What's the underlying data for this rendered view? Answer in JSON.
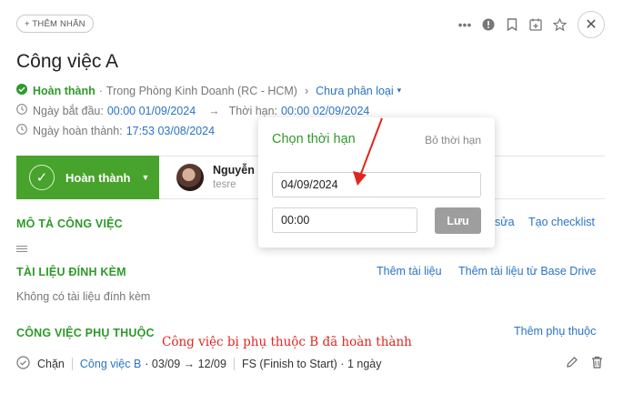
{
  "header": {
    "add_label": "+ THÊM NHÃN",
    "title": "Công việc A"
  },
  "status_line": {
    "status": "Hoàn thành",
    "separator": "·",
    "location": "Trong Phòng Kinh Doanh (RC - HCM)",
    "chevron": "›",
    "category": "Chưa phân loại"
  },
  "dates": {
    "start_label": "Ngày bắt đầu:",
    "start_value": "00:00 01/09/2024",
    "arrow": "→",
    "deadline_label": "Thời hạn:",
    "deadline_value": "00:00 02/09/2024",
    "completed_label": "Ngày hoàn thành:",
    "completed_value": "17:53 03/08/2024"
  },
  "status_button": {
    "label": "Hoàn thành"
  },
  "assignee": {
    "name": "Nguyễn I",
    "subtitle": "tesre"
  },
  "description": {
    "heading": "MÔ TẢ CÔNG VIỆC",
    "edit_link": "sửa",
    "checklist_link": "Tạo checklist"
  },
  "attachments": {
    "heading": "TÀI LIỆU ĐÍNH KÈM",
    "add_link": "Thêm tài liệu",
    "add_drive_link": "Thêm tài liệu từ Base Drive",
    "empty_text": "Không có tài liệu đính kèm"
  },
  "dependencies": {
    "heading": "CÔNG VIỆC PHỤ THUỘC",
    "add_link": "Thêm phụ thuộc",
    "annotation": "Công việc bị phụ thuộc B đã hoàn thành",
    "row": {
      "type": "Chặn",
      "task": "Công việc B",
      "range": "· 03/09 → 12/09",
      "relation": "FS (Finish to Start) · 1 ngày"
    }
  },
  "popup": {
    "title": "Chọn thời hạn",
    "clear": "Bỏ thời hạn",
    "date_value": "04/09/2024",
    "time_value": "00:00",
    "save": "Lưu"
  },
  "colors": {
    "accent_green": "#47a32b",
    "link_blue": "#2a73c7",
    "annotation_red": "#e0261f"
  }
}
